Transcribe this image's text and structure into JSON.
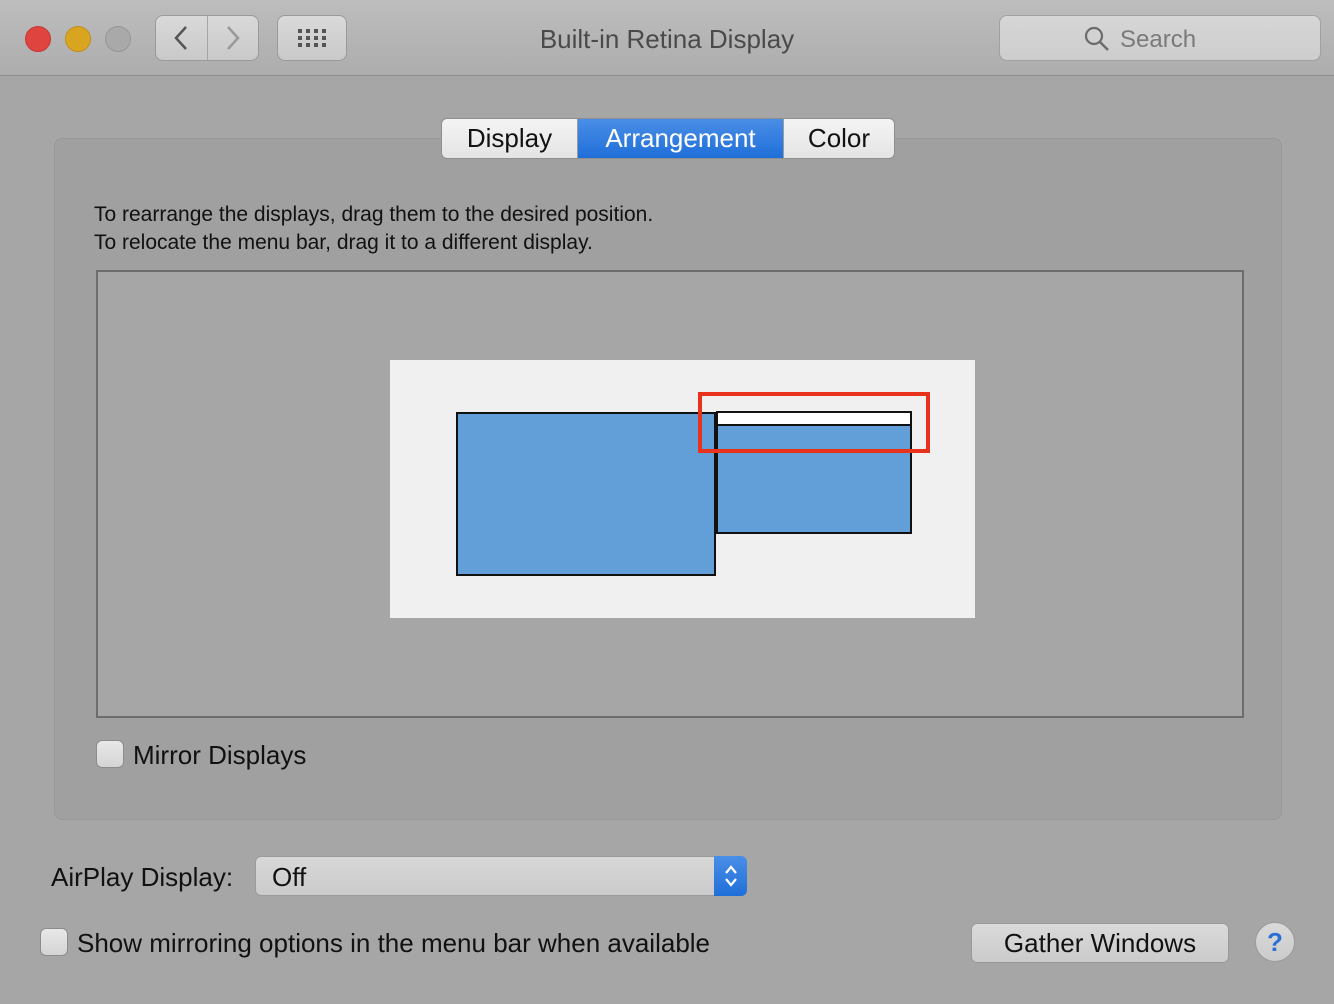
{
  "window": {
    "title": "Built-in Retina Display"
  },
  "toolbar": {
    "search_placeholder": "Search",
    "back_icon": "chevron-left-icon",
    "forward_icon": "chevron-right-icon",
    "grid_icon": "show-all-grid-icon"
  },
  "tabs": [
    {
      "label": "Display",
      "selected": false
    },
    {
      "label": "Arrangement",
      "selected": true
    },
    {
      "label": "Color",
      "selected": false
    }
  ],
  "arrangement": {
    "instruction_line1": "To rearrange the displays, drag them to the desired position.",
    "instruction_line2": "To relocate the menu bar, drag it to a different display."
  },
  "mirror": {
    "label": "Mirror Displays",
    "checked": false
  },
  "airplay": {
    "label": "AirPlay Display:",
    "value": "Off"
  },
  "mirroring_option": {
    "label": "Show mirroring options in the menu bar when available",
    "checked": false
  },
  "buttons": {
    "gather": "Gather Windows",
    "help": "?"
  },
  "colors": {
    "display_blue": "#629fd8",
    "accent_blue": "#1f6fd9",
    "highlight_red": "#e8321c"
  }
}
